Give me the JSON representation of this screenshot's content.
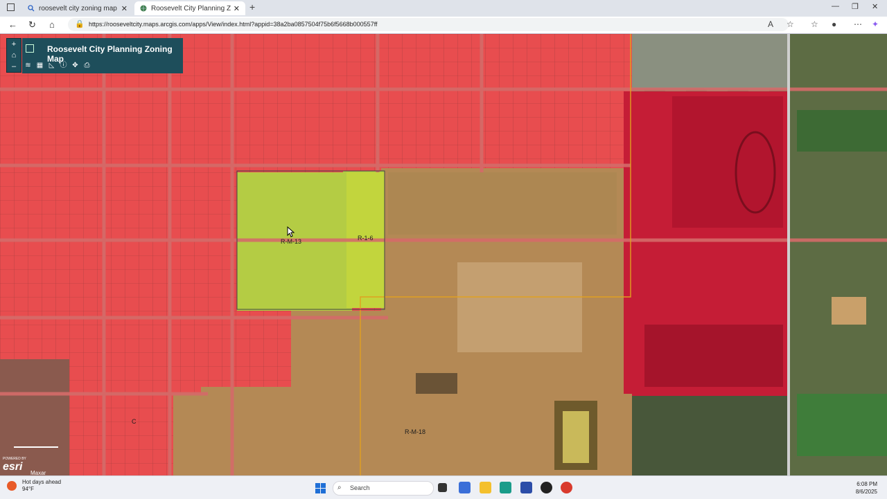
{
  "browser": {
    "tabs": [
      {
        "title": "roosevelt city zoning map - Search",
        "active": false
      },
      {
        "title": "Roosevelt City Planning Zoning Map",
        "active": true
      }
    ],
    "url": "https://rooseveltcity.maps.arcgis.com/apps/View/index.html?appid=38a2ba0857504f75b6f5668b000557ff"
  },
  "map": {
    "title": "Roosevelt City Planning Zoning Map",
    "zone_labels": {
      "rm13": "R-M-13",
      "r16": "R-1-6",
      "rm18": "R-M-18",
      "c": "C"
    },
    "attribution": {
      "powered": "POWERED BY",
      "brand": "esri",
      "imagery": "Maxar"
    },
    "zoom_in": "+",
    "zoom_out": "–",
    "colors": {
      "residential_red": "#e84d4f",
      "rm13_green": "#b4cc44",
      "rm18_tan": "#b48955",
      "commercial_crimson": "#c51d36",
      "panel": "#1e4e5b"
    }
  },
  "taskbar": {
    "weather_title": "Hot days ahead",
    "weather_temp": "94°F",
    "search_label": "Search",
    "time": "6:08 PM",
    "date": "8/6/2025"
  }
}
